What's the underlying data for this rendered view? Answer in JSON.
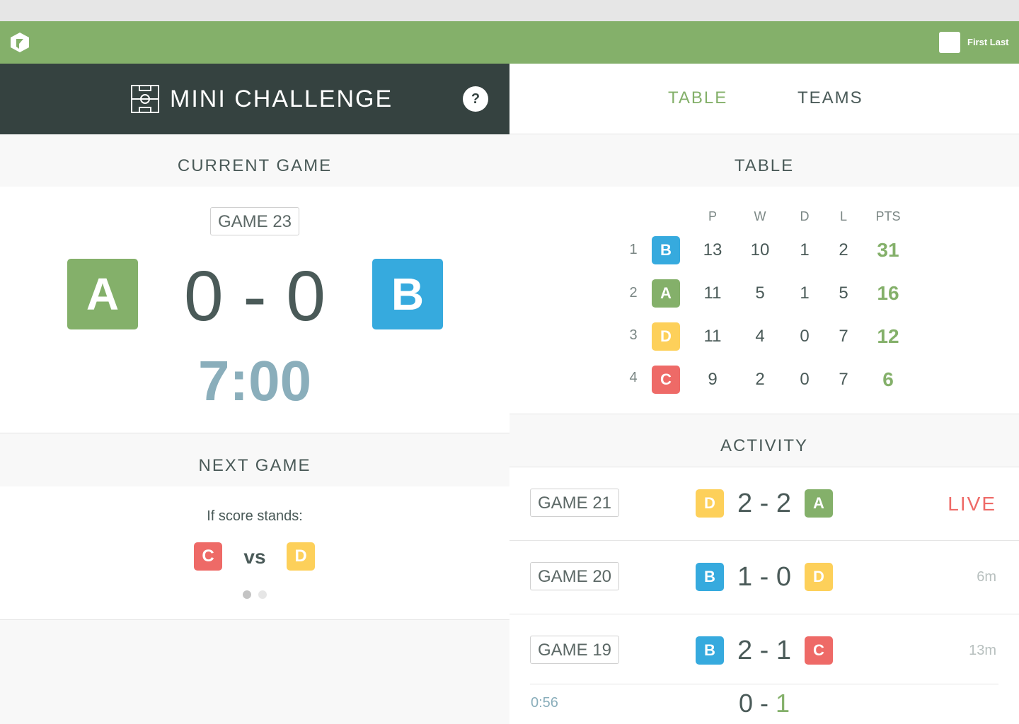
{
  "header": {
    "username": "First Last"
  },
  "app": {
    "title": "MINI CHALLENGE",
    "help_label": "?"
  },
  "current_game": {
    "section_title": "CURRENT GAME",
    "game_label": "GAME 23",
    "home_team": "A",
    "away_team": "B",
    "score": "0 - 0",
    "timer": "7:00"
  },
  "next_game": {
    "section_title": "NEXT GAME",
    "caption": "If score stands:",
    "team_1": "C",
    "vs_label": "vs",
    "team_2": "D",
    "pager": {
      "pages": 2,
      "active": 1
    }
  },
  "tabs": [
    {
      "label": "TABLE",
      "active": true
    },
    {
      "label": "TEAMS",
      "active": false
    }
  ],
  "table": {
    "section_title": "TABLE",
    "columns": [
      "P",
      "W",
      "D",
      "L",
      "PTS"
    ],
    "rows": [
      {
        "rank": "1",
        "team": "B",
        "p": "13",
        "w": "10",
        "d": "1",
        "l": "2",
        "pts": "31"
      },
      {
        "rank": "2",
        "team": "A",
        "p": "11",
        "w": "5",
        "d": "1",
        "l": "5",
        "pts": "16"
      },
      {
        "rank": "3",
        "team": "D",
        "p": "11",
        "w": "4",
        "d": "0",
        "l": "7",
        "pts": "12"
      },
      {
        "rank": "4",
        "team": "C",
        "p": "9",
        "w": "2",
        "d": "0",
        "l": "7",
        "pts": "6"
      }
    ]
  },
  "activity": {
    "section_title": "ACTIVITY",
    "items": [
      {
        "game": "GAME 21",
        "home": "D",
        "score": "2 - 2",
        "away": "A",
        "status": "LIVE"
      },
      {
        "game": "GAME 20",
        "home": "B",
        "score": "1 - 0",
        "away": "D",
        "status": "6m"
      },
      {
        "game": "GAME 19",
        "home": "B",
        "score": "2 - 1",
        "away": "C",
        "status": "13m"
      }
    ],
    "detail": {
      "time": "0:56",
      "home_goals": "0",
      "separator": "-",
      "away_goals": "1"
    }
  },
  "colors": {
    "brand_green": "#84b06a",
    "dark_header": "#354240",
    "team_A": "#84b06a",
    "team_B": "#36aade",
    "team_C": "#ee6a67",
    "team_D": "#fdd05a",
    "timer": "#8aaebb",
    "live": "#ee6a67"
  }
}
